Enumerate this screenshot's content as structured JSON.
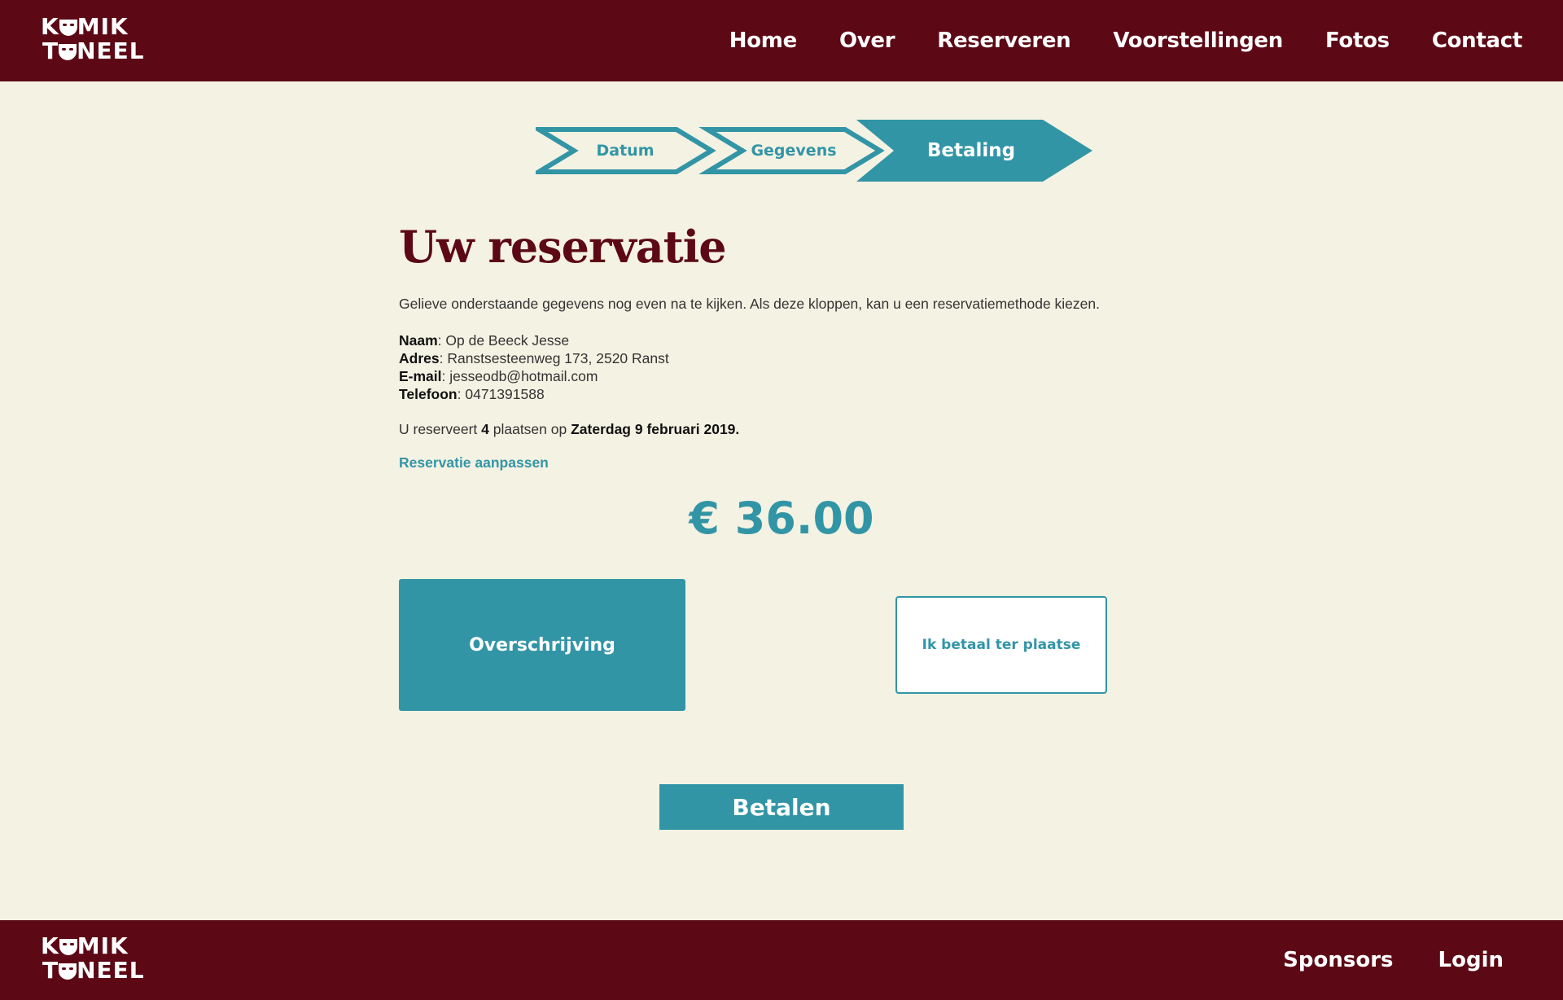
{
  "brand": {
    "line1_a": "K",
    "line1_b": "MIK",
    "line2_a": "T",
    "line2_b": "NEEL"
  },
  "nav": [
    "Home",
    "Over",
    "Reserveren",
    "Voorstellingen",
    "Fotos",
    "Contact"
  ],
  "steps": {
    "step1": "Datum",
    "step2": "Gegevens",
    "step3": "Betaling",
    "active": "Betaling",
    "accent_color": "#3295a6"
  },
  "page": {
    "title": "Uw reservatie",
    "intro": "Gelieve onderstaande gegevens nog even na te kijken. Als deze kloppen, kan u een reservatiemethode kiezen."
  },
  "details": [
    {
      "label": "Naam",
      "value": ": Op de Beeck Jesse"
    },
    {
      "label": "Adres",
      "value": ": Ranstsesteenweg 173, 2520 Ranst"
    },
    {
      "label": "E-mail",
      "value": ": jesseodb@hotmail.com"
    },
    {
      "label": "Telefoon",
      "value": ": 0471391588"
    }
  ],
  "summary": {
    "prefix": "U reserveert ",
    "seats": "4",
    "middle": " plaatsen op ",
    "date": "Zaterdag 9 februari 2019."
  },
  "edit_link": "Reservatie aanpassen",
  "price": "€ 36.00",
  "payment_methods": {
    "transfer": "Overschrijving",
    "on_site": "Ik betaal ter plaatse",
    "selected": "Overschrijving"
  },
  "pay_button": "Betalen",
  "footer_nav": [
    "Sponsors",
    "Login"
  ],
  "colors": {
    "brand": "#5c0915",
    "accent": "#3295a6",
    "background": "#f4f2e3"
  }
}
